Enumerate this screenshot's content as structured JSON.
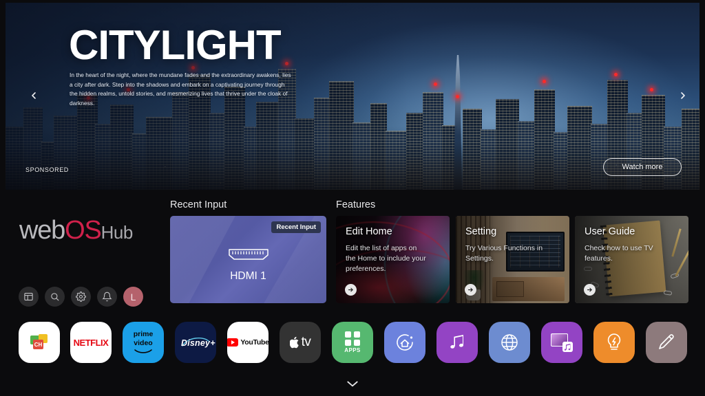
{
  "banner": {
    "title": "CITYLIGHT",
    "description": "In the heart of the night, where the mundane fades and the extraordinary awakens, lies a city after dark. Step into the shadows and embark on a captivating journey through the hidden realms, untold stories, and mesmerizing lives that thrive under the cloak of darkness.",
    "sponsored_label": "SPONSORED",
    "watch_more_label": "Watch more",
    "prev_icon": "chevron-left-icon",
    "next_icon": "chevron-right-icon"
  },
  "brand": {
    "web": "web",
    "os": "OS",
    "hub": "Hub",
    "os_color": "#d0214b"
  },
  "utility_bar": {
    "items": [
      {
        "name": "dashboard-icon",
        "label": "Dashboard"
      },
      {
        "name": "search-icon",
        "label": "Search"
      },
      {
        "name": "gear-icon",
        "label": "Settings"
      },
      {
        "name": "bell-icon",
        "label": "Notifications"
      },
      {
        "name": "avatar",
        "label": "L"
      }
    ]
  },
  "recent_input": {
    "section_title": "Recent Input",
    "badge": "Recent Input",
    "card_label": "HDMI 1",
    "icon": "hdmi-connector-icon",
    "accent": "#5b60a9"
  },
  "features": {
    "section_title": "Features",
    "cards": [
      {
        "title": "Edit Home",
        "description": "Edit the list of apps on the Home to include your preferences.",
        "arrow_icon": "arrow-right-icon"
      },
      {
        "title": "Setting",
        "description": "Try Various Functions in Settings.",
        "arrow_icon": "arrow-right-icon"
      },
      {
        "title": "User Guide",
        "description": "Check how to use TV features.",
        "arrow_icon": "arrow-right-icon"
      }
    ]
  },
  "dock": {
    "apps": [
      {
        "name": "channels",
        "label": "CH",
        "bg": "#ffffff"
      },
      {
        "name": "netflix",
        "label": "NETFLIX",
        "bg": "#ffffff"
      },
      {
        "name": "prime-video",
        "label_top": "prime",
        "label_bottom": "video",
        "bg": "#1ba0e8"
      },
      {
        "name": "disney-plus",
        "label": "Disney+",
        "bg": "#0d1a44"
      },
      {
        "name": "youtube",
        "label": "YouTube",
        "bg": "#ffffff"
      },
      {
        "name": "apple-tv",
        "label": "tv",
        "bg": "#333333"
      },
      {
        "name": "apps",
        "label": "APPS",
        "bg": "#56b870"
      },
      {
        "name": "home-hub",
        "label": "Home Hub",
        "bg": "#6c82dd"
      },
      {
        "name": "music",
        "label": "Music",
        "bg": "#9344c4"
      },
      {
        "name": "web-browser",
        "label": "Web Browser",
        "bg": "#6d8cd0"
      },
      {
        "name": "media-player",
        "label": "Media Player",
        "bg": "#9344c4"
      },
      {
        "name": "tips",
        "label": "Tips",
        "bg": "#ee8c2b"
      },
      {
        "name": "edit",
        "label": "Edit",
        "bg": "#8d7a7c"
      }
    ],
    "scroll_down_icon": "chevron-down-icon"
  }
}
